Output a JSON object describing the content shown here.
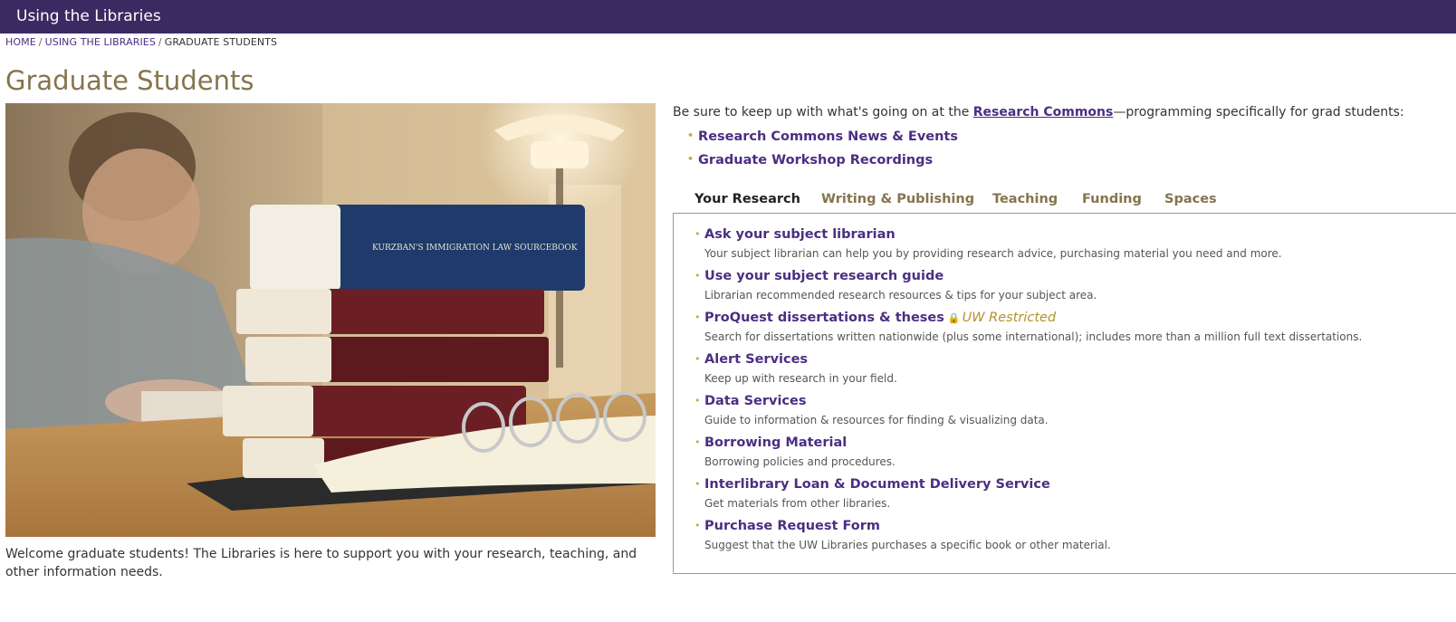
{
  "header": {
    "title": "Using the Libraries"
  },
  "breadcrumb": {
    "home": "HOME",
    "section": "USING THE LIBRARIES",
    "current": "GRADUATE STUDENTS",
    "sep": "/"
  },
  "page": {
    "title": "Graduate Students"
  },
  "welcome": "Welcome graduate students! The Libraries is here to support you with your research, teaching, and other information needs.",
  "intro": {
    "before": "Be sure to keep up with what's going on at the ",
    "link": "Research Commons",
    "after": "—programming specifically for grad students:"
  },
  "rc_links": [
    {
      "label": "Research Commons News & Events"
    },
    {
      "label": "Graduate Workshop Recordings"
    }
  ],
  "tabs": [
    {
      "label": "Your Research",
      "active": true
    },
    {
      "label": "Writing & Publishing"
    },
    {
      "label": "Teaching"
    },
    {
      "label": "Funding"
    },
    {
      "label": "Spaces"
    }
  ],
  "resources": [
    {
      "title": "Ask your subject librarian",
      "desc": "Your subject librarian can help you by providing research advice, purchasing material you need and more."
    },
    {
      "title": "Use your subject research guide",
      "desc": "Librarian recommended research resources & tips for your subject area."
    },
    {
      "title": "ProQuest dissertations & theses",
      "restricted": "UW Restricted",
      "desc": "Search for dissertations written nationwide (plus some international); includes more than a million full text dissertations."
    },
    {
      "title": "Alert Services",
      "desc": "Keep up with research in your field."
    },
    {
      "title": "Data Services",
      "desc": "Guide to information & resources for finding & visualizing data."
    },
    {
      "title": "Borrowing Material",
      "desc": "Borrowing policies and procedures."
    },
    {
      "title": "Interlibrary Loan & Document Delivery Service",
      "desc": "Get materials from other libraries."
    },
    {
      "title": "Purchase Request Form",
      "desc": "Suggest that the UW Libraries purchases a specific book or other material."
    }
  ],
  "hero_image": {
    "book_spine_text": "KURZBAN'S IMMIGRATION LAW SOURCEBOOK",
    "colors": {
      "book_blue": "#1f3b6b",
      "book_red": "#6b1f24",
      "lamp": "#fff3dc"
    }
  },
  "colors": {
    "purple": "#4b2e83",
    "header_bg": "#3b2a61",
    "gold": "#85754d",
    "bullet": "#c4a84a",
    "restricted": "#b7912a"
  }
}
